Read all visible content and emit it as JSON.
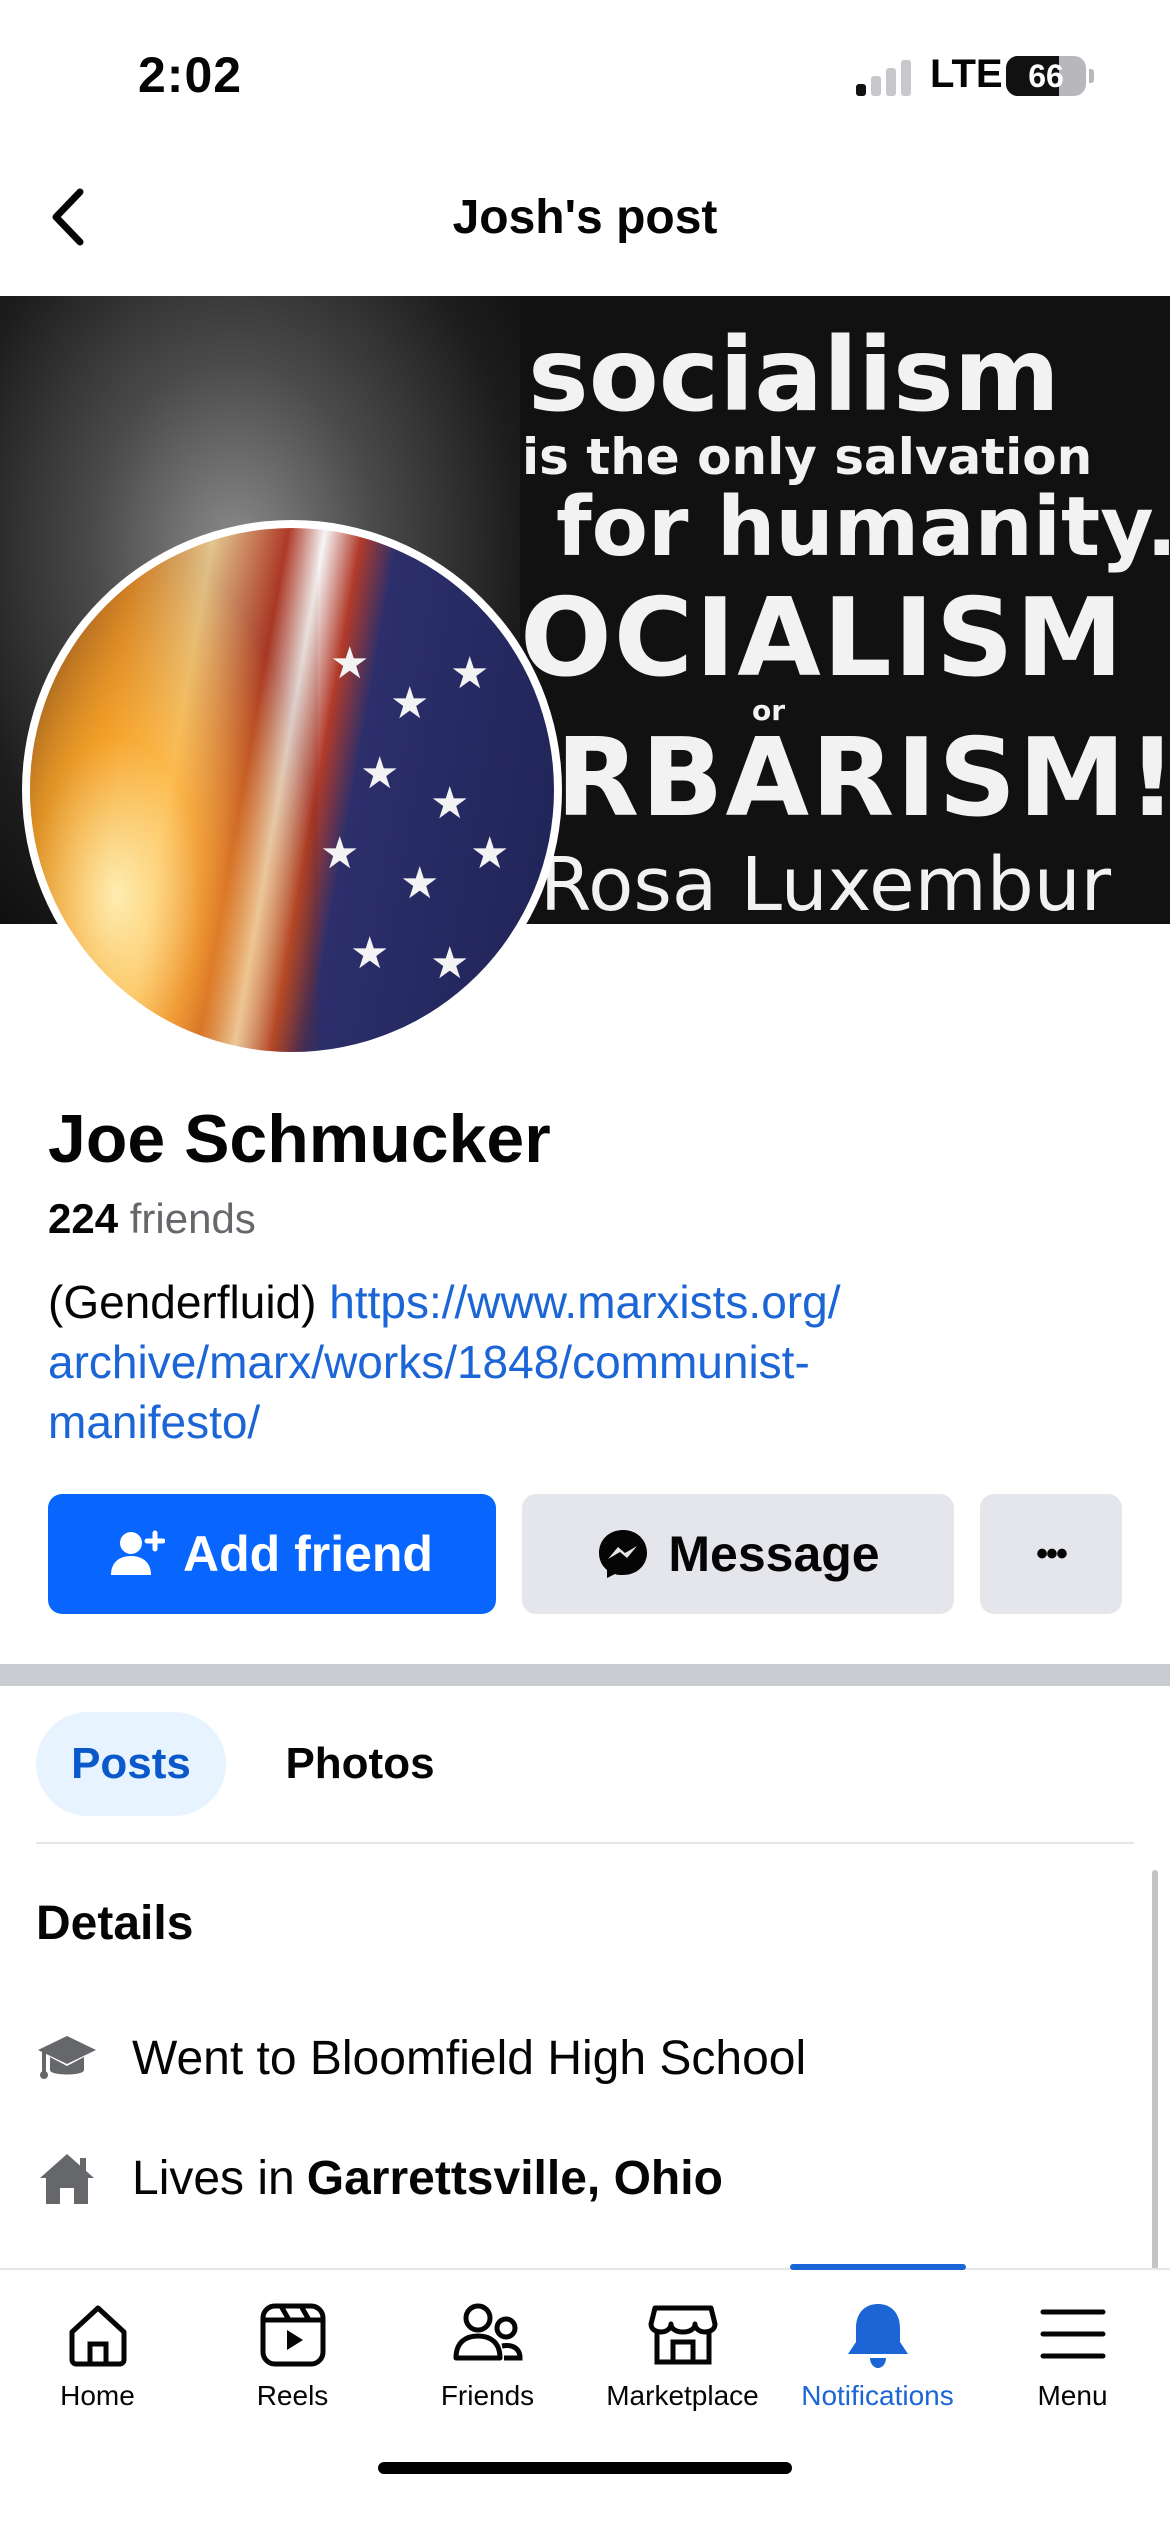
{
  "status_bar": {
    "time": "2:02",
    "network": "LTE",
    "battery": "66"
  },
  "header": {
    "title": "Josh's post"
  },
  "cover": {
    "lines": [
      "socialism",
      "is the only salvation",
      "for humanity.",
      "OCIALISM",
      "or",
      "RBARISM!",
      "Rosa Luxembur"
    ]
  },
  "profile": {
    "name": "Joe Schmucker",
    "friends_count": "224",
    "friends_label": "friends",
    "bio_prefix": "(Genderfluid)",
    "bio_link_line1": "https://www.marxists.org/",
    "bio_link_line2": "archive/marx/works/1848/communist-",
    "bio_link_line3": "manifesto/"
  },
  "actions": {
    "add_friend": "Add friend",
    "message": "Message",
    "more": "•••"
  },
  "tabs": [
    {
      "label": "Posts"
    },
    {
      "label": "Photos"
    }
  ],
  "details": {
    "title": "Details",
    "education": "Went to Bloomfield High School",
    "lives_prefix": "Lives in",
    "lives_place": "Garrettsville, Ohio"
  },
  "nav": [
    {
      "label": "Home",
      "icon": "home-icon"
    },
    {
      "label": "Reels",
      "icon": "reels-icon"
    },
    {
      "label": "Friends",
      "icon": "friends-icon"
    },
    {
      "label": "Marketplace",
      "icon": "marketplace-icon"
    },
    {
      "label": "Notifications",
      "icon": "bell-icon"
    },
    {
      "label": "Menu",
      "icon": "menu-icon"
    }
  ],
  "colors": {
    "accent": "#0866ff",
    "link": "#1b65d6",
    "secondary_bg": "#e4e6eb"
  }
}
